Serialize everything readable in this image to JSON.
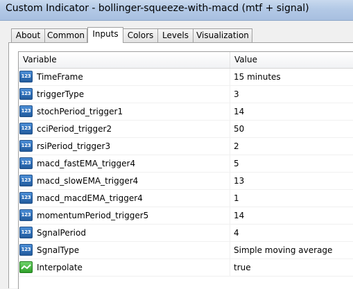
{
  "window": {
    "title": "Custom Indicator - bollinger-squeeze-with-macd (mtf + signal)"
  },
  "tabs": [
    {
      "label": "About"
    },
    {
      "label": "Common"
    },
    {
      "label": "Inputs",
      "active": true
    },
    {
      "label": "Colors"
    },
    {
      "label": "Levels"
    },
    {
      "label": "Visualization"
    }
  ],
  "grid": {
    "columns": {
      "variable": "Variable",
      "value": "Value"
    },
    "rows": [
      {
        "icon": "numeric-icon",
        "icon_text": "123",
        "variable": "TimeFrame",
        "value": "15 minutes"
      },
      {
        "icon": "numeric-icon",
        "icon_text": "123",
        "variable": "triggerType",
        "value": "3"
      },
      {
        "icon": "numeric-icon",
        "icon_text": "123",
        "variable": "stochPeriod_trigger1",
        "value": "14"
      },
      {
        "icon": "numeric-icon",
        "icon_text": "123",
        "variable": "cciPeriod_trigger2",
        "value": "50"
      },
      {
        "icon": "numeric-icon",
        "icon_text": "123",
        "variable": "rsiPeriod_trigger3",
        "value": "2"
      },
      {
        "icon": "numeric-icon",
        "icon_text": "123",
        "variable": "macd_fastEMA_trigger4",
        "value": "5"
      },
      {
        "icon": "numeric-icon",
        "icon_text": "123",
        "variable": "macd_slowEMA_trigger4",
        "value": "13"
      },
      {
        "icon": "numeric-icon",
        "icon_text": "123",
        "variable": "macd_macdEMA_trigger4",
        "value": "1"
      },
      {
        "icon": "numeric-icon",
        "icon_text": "123",
        "variable": "momentumPeriod_trigger5",
        "value": "14"
      },
      {
        "icon": "numeric-icon",
        "icon_text": "123",
        "variable": "SgnalPeriod",
        "value": "4"
      },
      {
        "icon": "numeric-icon",
        "icon_text": "123",
        "variable": "SgnalType",
        "value": "Simple moving average"
      },
      {
        "icon": "boolean-icon",
        "icon_text": "",
        "variable": "Interpolate",
        "value": "true"
      }
    ]
  },
  "colors": {
    "titlebar": "#b3c9e6",
    "numeric_icon": "#2f6fb8",
    "boolean_icon": "#2fa02a"
  }
}
